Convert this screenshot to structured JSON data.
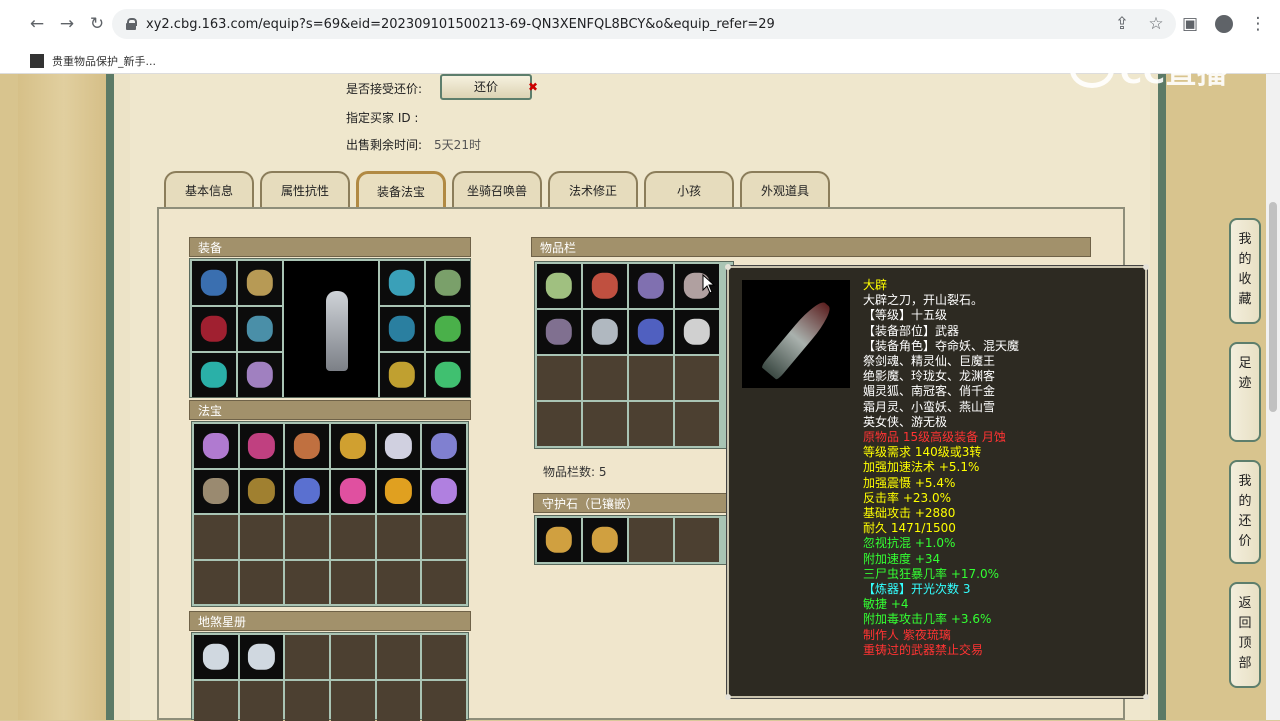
{
  "browser": {
    "url": "xy2.cbg.163.com/equip?s=69&eid=202309101500213-69-QN3XENFQL8BCY&o&equip_refer=29",
    "bookmark": "贵重物品保护_新手..."
  },
  "watermark": "CC直播",
  "info": {
    "accept_offer_label": "是否接受还价:",
    "offer_button": "还价",
    "offer_x": "✖",
    "buyer_id_label": "指定买家 ID :",
    "remaining_label": "出售剩余时间:",
    "remaining_value": "5天21时"
  },
  "tabs": [
    "基本信息",
    "属性抗性",
    "装备法宝",
    "坐骑召唤兽",
    "法术修正",
    "小孩",
    "外观道具"
  ],
  "sections": {
    "equipment": "装备",
    "fabao": "法宝",
    "disha": "地煞星册",
    "items": "物品栏",
    "items_count": "物品栏数: 5",
    "guardian": "守护石（已镶嵌）"
  },
  "tooltip": {
    "lines": [
      {
        "text": "大辟",
        "color": "yellow"
      },
      {
        "text": "大辟之刀，开山裂石。",
        "color": "white"
      },
      {
        "text": "【等级】十五级",
        "color": "white"
      },
      {
        "text": "【装备部位】武器",
        "color": "white"
      },
      {
        "text": "【装备角色】夺命妖、混天魔",
        "color": "white"
      },
      {
        "text": "祭剑魂、精灵仙、巨魔王",
        "color": "white"
      },
      {
        "text": "绝影魔、玲珑女、龙渊客",
        "color": "white"
      },
      {
        "text": "媚灵狐、南冠客、俏千金",
        "color": "white"
      },
      {
        "text": "霜月灵、小蛮妖、燕山雪",
        "color": "white"
      },
      {
        "text": "英女侠、游无极",
        "color": "white"
      },
      {
        "text": "原物品 15级高级装备 月蚀",
        "color": "red"
      },
      {
        "text": "等级需求 140级或3转",
        "color": "yellow"
      },
      {
        "text": "加强加速法术 +5.1%",
        "color": "yellow"
      },
      {
        "text": "加强震慑 +5.4%",
        "color": "yellow"
      },
      {
        "text": "反击率 +23.0%",
        "color": "yellow"
      },
      {
        "text": "基础攻击 +2880",
        "color": "yellow"
      },
      {
        "text": "耐久 1471/1500",
        "color": "yellow"
      },
      {
        "text": "忽视抗混 +1.0%",
        "color": "green"
      },
      {
        "text": "附加速度 +34",
        "color": "green"
      },
      {
        "text": "三尸虫狂暴几率 +17.0%",
        "color": "green"
      },
      {
        "text": " ",
        "color": "white"
      },
      {
        "text": "【炼器】开光次数 3",
        "color": "cyan"
      },
      {
        "text": "敏捷 +4",
        "color": "green"
      },
      {
        "text": "附加毒攻击几率 +3.6%",
        "color": "green"
      },
      {
        "text": "制作人 紫夜琉璃",
        "color": "red"
      },
      {
        "text": " ",
        "color": "white"
      },
      {
        "text": "重铸过的武器禁止交易",
        "color": "red"
      }
    ]
  },
  "side_tabs": [
    "我的收藏",
    "足迹",
    "我的还价",
    "返回顶部"
  ],
  "colors": {
    "yellow": "#ffff00",
    "white": "#ffffff",
    "red": "#ff3333",
    "green": "#33ff33",
    "cyan": "#33ffff"
  }
}
